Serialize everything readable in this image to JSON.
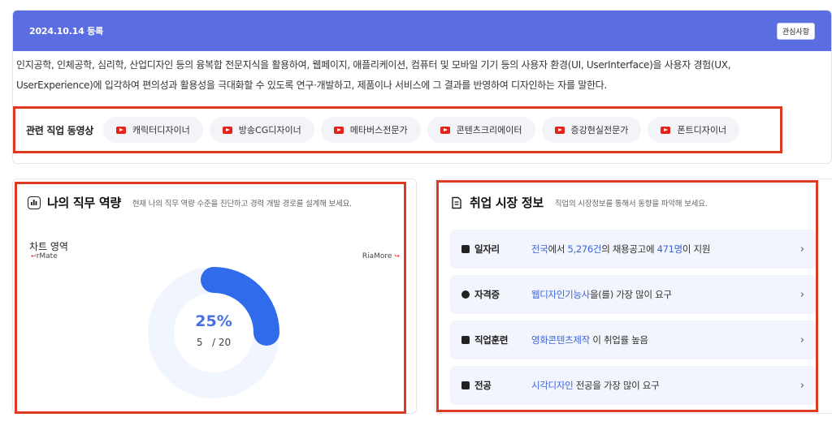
{
  "header": {
    "reg_date": "2024.10.14 등록",
    "interest_button": "관심사항"
  },
  "description": {
    "line1": "인지공학, 인체공학, 심리학, 산업디자인 등의 융복합 전문지식을 활용하여, 웹페이지, 애플리케이션, 컴퓨터 및 모바일 기기 등의 사용자 환경(UI, UserInterface)을 사용자 경험(UX,",
    "line2": "UserExperience)에 입각하여 편의성과 활용성을 극대화할 수 있도록 연구·개발하고, 제품이나 서비스에 그 결과를 반영하여 디자인하는 자를 말한다."
  },
  "videos": {
    "title": "관련 직업 동영상",
    "items": [
      {
        "label": "캐릭터디자이너"
      },
      {
        "label": "방송CG디자이너"
      },
      {
        "label": "메타버스전문가"
      },
      {
        "label": "콘텐츠크리에이터"
      },
      {
        "label": "증강현실전문가"
      },
      {
        "label": "폰트디자이너"
      }
    ]
  },
  "competency": {
    "title": "나의 직무 역량",
    "subtitle": "현재 나의 직무 역량 수준을 진단하고 경력 개발 경로를 설계해 보세요.",
    "chart_label": "차트 영역",
    "left_label": "rMate",
    "right_label": "RiaMore",
    "percent_text": "25%",
    "current": "5",
    "total": "/ 20",
    "progress": 0.25,
    "colors": {
      "ring": "#2f6bea",
      "track": "#f1f5fd"
    }
  },
  "market": {
    "title": "취업 시장 정보",
    "subtitle": "직업의 시장정보를 통해서 동향을 파악해 보세요.",
    "rows": [
      {
        "label": "일자리",
        "parts": [
          "전국",
          "에서 ",
          "5,276건",
          "의 채용공고에 ",
          "471명",
          "이 지원"
        ],
        "icon": "briefcase-icon"
      },
      {
        "label": "자격증",
        "parts": [
          "웹디자인기능사",
          "을(를) 가장 많이 요구"
        ],
        "icon": "certificate-icon"
      },
      {
        "label": "직업훈련",
        "parts": [
          "영화콘텐츠제작",
          " 이 취업률 높음"
        ],
        "icon": "training-icon"
      },
      {
        "label": "전공",
        "parts": [
          "시각디자인",
          " 전공을 가장 많이 요구"
        ],
        "icon": "major-icon"
      }
    ]
  },
  "chevron": "›",
  "accent": "#5b6ee1",
  "highlight": "#dc3b22"
}
